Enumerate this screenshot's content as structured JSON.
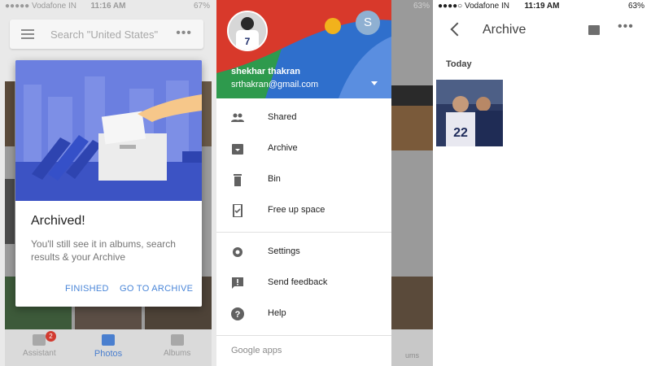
{
  "panel1": {
    "status": {
      "carrier": "●●●●● Vodafone IN",
      "time": "11:16 AM",
      "battery": "67%"
    },
    "search": {
      "placeholder": "Search \"United States\""
    },
    "dialog": {
      "title": "Archived!",
      "message": "You'll still see it in albums, search results & your Archive",
      "finished_label": "FINISHED",
      "go_label": "GO TO ARCHIVE"
    },
    "tabs": [
      {
        "label": "Assistant",
        "badge": "2",
        "icon": "assistant-icon"
      },
      {
        "label": "Photos",
        "icon": "photos-icon"
      },
      {
        "label": "Albums",
        "icon": "albums-icon"
      }
    ]
  },
  "panel2": {
    "status": {
      "battery": "63%"
    },
    "user": {
      "name": "shekhar thakran",
      "email": "srthakran@gmail.com",
      "initial": "S"
    },
    "menu": [
      {
        "label": "Shared",
        "icon": "people-icon"
      },
      {
        "label": "Archive",
        "icon": "archive-icon"
      },
      {
        "label": "Bin",
        "icon": "bin-icon"
      },
      {
        "label": "Free up space",
        "icon": "phone-check-icon"
      },
      {
        "label": "Settings",
        "icon": "gear-icon"
      },
      {
        "label": "Send feedback",
        "icon": "feedback-icon"
      },
      {
        "label": "Help",
        "icon": "help-icon"
      }
    ],
    "google_apps": "Google apps",
    "behind_label": "ums"
  },
  "panel3": {
    "status": {
      "carrier": "●●●●○ Vodafone IN",
      "time": "11:19 AM",
      "battery": "63%"
    },
    "title": "Archive",
    "section": "Today"
  },
  "colors": {
    "accent": "#4a86d8",
    "drawer_blue": "#2f6fcc",
    "drawer_red": "#d8392b",
    "drawer_green": "#2e9a4d",
    "drawer_yellow": "#f1b21c",
    "badge_red": "#d23b30"
  }
}
